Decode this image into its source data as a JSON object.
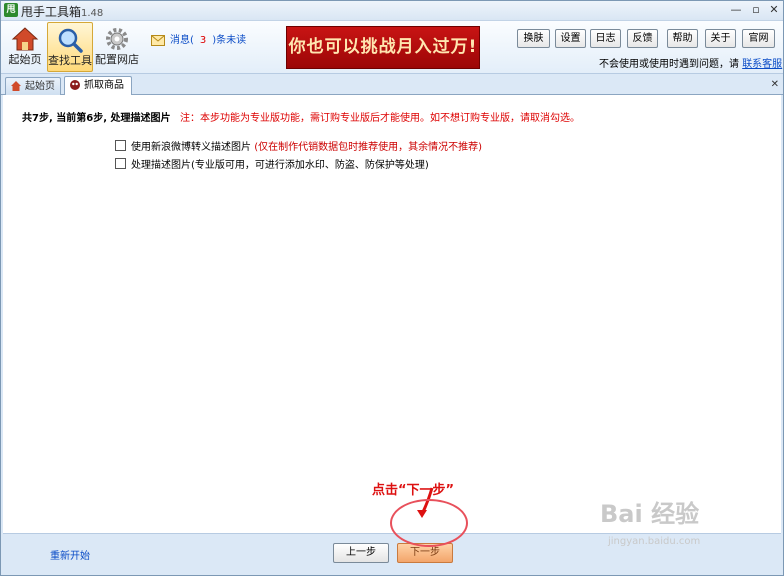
{
  "window": {
    "title": "甩手工具箱",
    "version": "1.48",
    "app_icon_text": "甩",
    "controls": [
      "—",
      "▫",
      "✕"
    ]
  },
  "toolbar": {
    "buttons": [
      {
        "label": "起始页",
        "icon": "home-icon"
      },
      {
        "label": "查找工具",
        "icon": "magnifier-icon"
      },
      {
        "label": "配置网店",
        "icon": "gear-icon"
      }
    ],
    "message": {
      "prefix": "消息(",
      "count": "3",
      "suffix": ")条未读"
    },
    "banner": "你也可以挑战月入过万!",
    "right_buttons": [
      "换肤",
      "设置",
      "日志",
      "反馈",
      "帮助",
      "关于",
      "官网"
    ],
    "help_text": "不会使用或使用时遇到问题，请",
    "help_link": "联系客服"
  },
  "tabs": [
    {
      "label": "起始页",
      "icon": "home-icon",
      "active": false
    },
    {
      "label": "抓取商品",
      "icon": "grab-icon",
      "active": true
    }
  ],
  "content": {
    "step_text": "共7步, 当前第6步, 处理描述图片",
    "step_note": "注：本步功能为专业版功能，需订购专业版后才能使用。如不想订购专业版，请取消勾选。",
    "options": [
      {
        "label": "使用新浪微博转义描述图片",
        "hint": "(仅在制作代销数据包时推荐使用，其余情况不推荐)",
        "checked": false
      },
      {
        "label": "处理描述图片(专业版可用，可进行添加水印、防盗、防保护等处理)",
        "hint": "",
        "checked": false
      }
    ]
  },
  "bottom": {
    "restart": "重新开始",
    "prev": "上一步",
    "next": "下一步",
    "annotation": "点击“下一步”"
  },
  "watermark": {
    "main": "Bai 经验",
    "sub": "jingyan.baidu.com"
  },
  "colors": {
    "accent": "#0b4cc7",
    "warning": "#dd0000",
    "banner": "#c81414",
    "highlight": "#e8505b"
  }
}
